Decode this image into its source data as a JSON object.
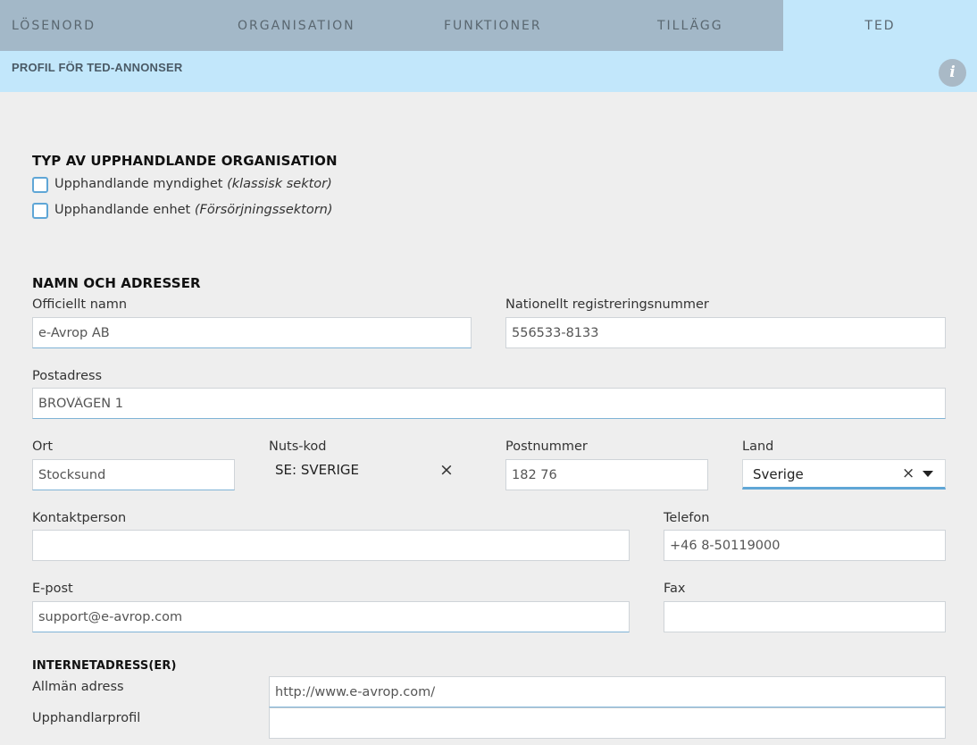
{
  "tabs": [
    {
      "label": "LÖSENORD"
    },
    {
      "label": "ORGANISATION"
    },
    {
      "label": "FUNKTIONER"
    },
    {
      "label": "TILLÄGG"
    },
    {
      "label": "TED"
    }
  ],
  "header": {
    "title": "PROFIL FÖR TED-ANNONSER",
    "info_icon": "i"
  },
  "org_type": {
    "title": "TYP AV UPPHANDLANDE ORGANISATION",
    "options": [
      {
        "label": "Upphandlande myndighet",
        "note": "(klassisk sektor)",
        "checked": false
      },
      {
        "label": "Upphandlande enhet",
        "note": "(Försörjningssektorn)",
        "checked": false
      }
    ]
  },
  "names": {
    "title": "NAMN OCH ADRESSER",
    "official_name": {
      "label": "Officiellt namn",
      "value": "e-Avrop AB"
    },
    "reg_number": {
      "label": "Nationellt registreringsnummer",
      "value": "556533-8133"
    },
    "postal_address": {
      "label": "Postadress",
      "value": "BROVÄGEN 1"
    },
    "city": {
      "label": "Ort",
      "value": "Stocksund"
    },
    "nuts": {
      "label": "Nuts-kod",
      "value": "SE: SVERIGE",
      "clear": "×"
    },
    "postcode": {
      "label": "Postnummer",
      "value": "182 76"
    },
    "country": {
      "label": "Land",
      "value": "Sverige",
      "clear": "×"
    },
    "contact": {
      "label": "Kontaktperson",
      "value": ""
    },
    "phone": {
      "label": "Telefon",
      "value": "+46 8-50119000"
    },
    "email": {
      "label": "E-post",
      "value": "support@e-avrop.com"
    },
    "fax": {
      "label": "Fax",
      "value": ""
    }
  },
  "internet": {
    "title": "INTERNETADRESS(ER)",
    "general": {
      "label": "Allmän adress",
      "value": "http://www.e-avrop.com/"
    },
    "buyer_profile": {
      "label": "Upphandlarprofil",
      "value": ""
    }
  }
}
